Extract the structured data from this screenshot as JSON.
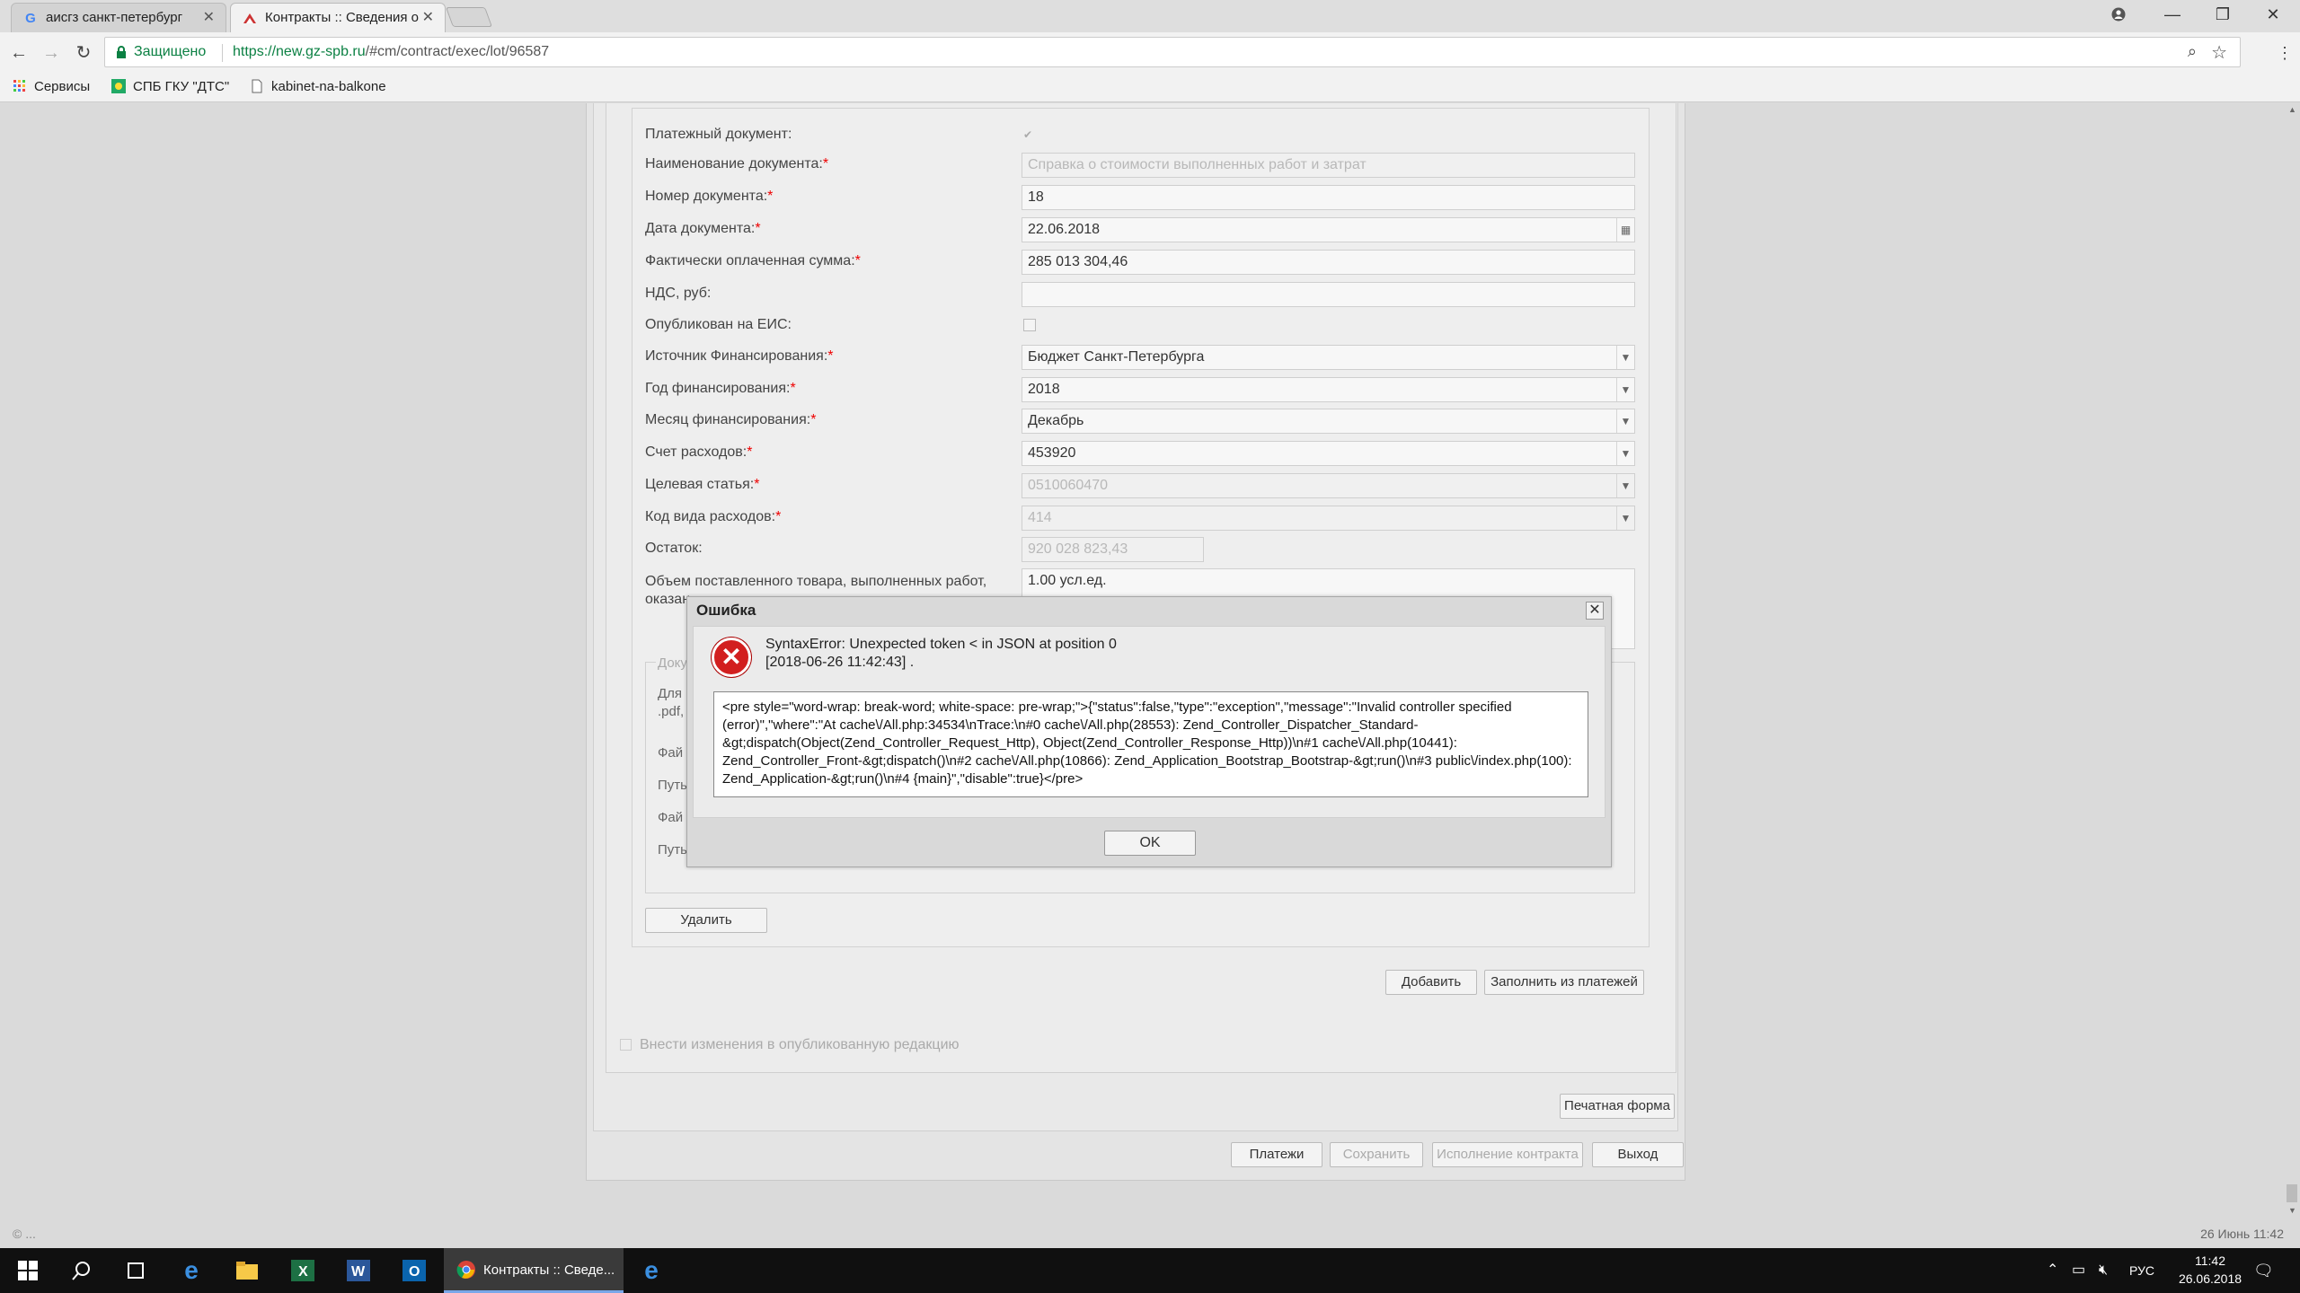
{
  "browser": {
    "tabs": [
      {
        "label": "аисгз санкт-петербург",
        "favicon": "G"
      },
      {
        "label": "Контракты :: Сведения о",
        "favicon": "site-icon"
      }
    ],
    "secure_label": "Защищено",
    "url_host": "https://new.gz-spb.ru",
    "url_path": "/#cm/contract/exec/lot/96587",
    "bookmarks": [
      {
        "label": "Сервисы",
        "icon": "apps-icon"
      },
      {
        "label": "СПБ ГКУ \"ДТС\"",
        "icon": "site-icon"
      },
      {
        "label": "kabinet-na-balkone",
        "icon": "page-icon"
      }
    ]
  },
  "form": {
    "fields": [
      {
        "label": "Платежный документ:",
        "required": false,
        "kind": "checkbox-checked",
        "value": ""
      },
      {
        "label": "Наименование документа:",
        "required": true,
        "kind": "text-disabled",
        "value": "Справка о стоимости выполненных работ и затрат"
      },
      {
        "label": "Номер документа:",
        "required": true,
        "kind": "text",
        "value": "18"
      },
      {
        "label": "Дата документа:",
        "required": true,
        "kind": "date",
        "value": "22.06.2018"
      },
      {
        "label": "Фактически оплаченная сумма:",
        "required": true,
        "kind": "text",
        "value": "285 013 304,46"
      },
      {
        "label": "НДС, руб:",
        "required": false,
        "kind": "text",
        "value": ""
      },
      {
        "label": "Опубликован на ЕИС:",
        "required": false,
        "kind": "checkbox",
        "value": ""
      },
      {
        "label": "Источник Финансирования:",
        "required": true,
        "kind": "select",
        "value": "Бюджет Санкт-Петербурга"
      },
      {
        "label": "Год финансирования:",
        "required": true,
        "kind": "select",
        "value": "2018"
      },
      {
        "label": "Месяц финансирования:",
        "required": true,
        "kind": "select",
        "value": "Декабрь"
      },
      {
        "label": "Счет расходов:",
        "required": true,
        "kind": "select",
        "value": "453920"
      },
      {
        "label": "Целевая статья:",
        "required": true,
        "kind": "select-disabled",
        "value": "0510060470"
      },
      {
        "label": "Код вида расходов:",
        "required": true,
        "kind": "select-disabled",
        "value": "414"
      },
      {
        "label": "Остаток:",
        "required": false,
        "kind": "short-disabled",
        "value": "920 028 823,43"
      },
      {
        "label": "Объем поставленного товара, выполненных работ, оказан",
        "required": false,
        "kind": "textarea",
        "value": "1.00 усл.ед."
      }
    ],
    "doc_section": {
      "legend": "Доку",
      "hint_1": "Для",
      "hint_2": ".pdf,",
      "rows": [
        "Фай",
        "Путь",
        "Фай",
        "Путь"
      ]
    },
    "delete_button": "Удалить",
    "add_button": "Добавить",
    "fill_button": "Заполнить из платежей",
    "publish_checkbox_label": "Внести изменения в опубликованную редакцию",
    "print_button": "Печатная форма",
    "bottom_buttons": [
      "Платежи",
      "Сохранить",
      "Исполнение контракта",
      "Выход"
    ]
  },
  "dialog": {
    "title": "Ошибка",
    "message": "SyntaxError: Unexpected token < in JSON at position 0\n[2018-06-26 11:42:43] .",
    "details": "<pre style=\"word-wrap: break-word; white-space: pre-wrap;\">{\"status\":false,\"type\":\"exception\",\"message\":\"Invalid controller specified (error)\",\"where\":\"At cache\\/All.php:34534\\nTrace:\\n#0 cache\\/All.php(28553): Zend_Controller_Dispatcher_Standard-&gt;dispatch(Object(Zend_Controller_Request_Http), Object(Zend_Controller_Response_Http))\\n#1 cache\\/All.php(10441): Zend_Controller_Front-&gt;dispatch()\\n#2 cache\\/All.php(10866): Zend_Application_Bootstrap_Bootstrap-&gt;run()\\n#3 public\\/index.php(100): Zend_Application-&gt;run()\\n#4 {main}\",\"disable\":true}</pre>",
    "ok_label": "OK"
  },
  "status_bar": {
    "left": "© ...",
    "right": "26 Июнь 11:42"
  },
  "taskbar": {
    "active_window": "Контракты :: Сведе...",
    "lang": "РУС",
    "time": "11:42",
    "date": "26.06.2018"
  }
}
